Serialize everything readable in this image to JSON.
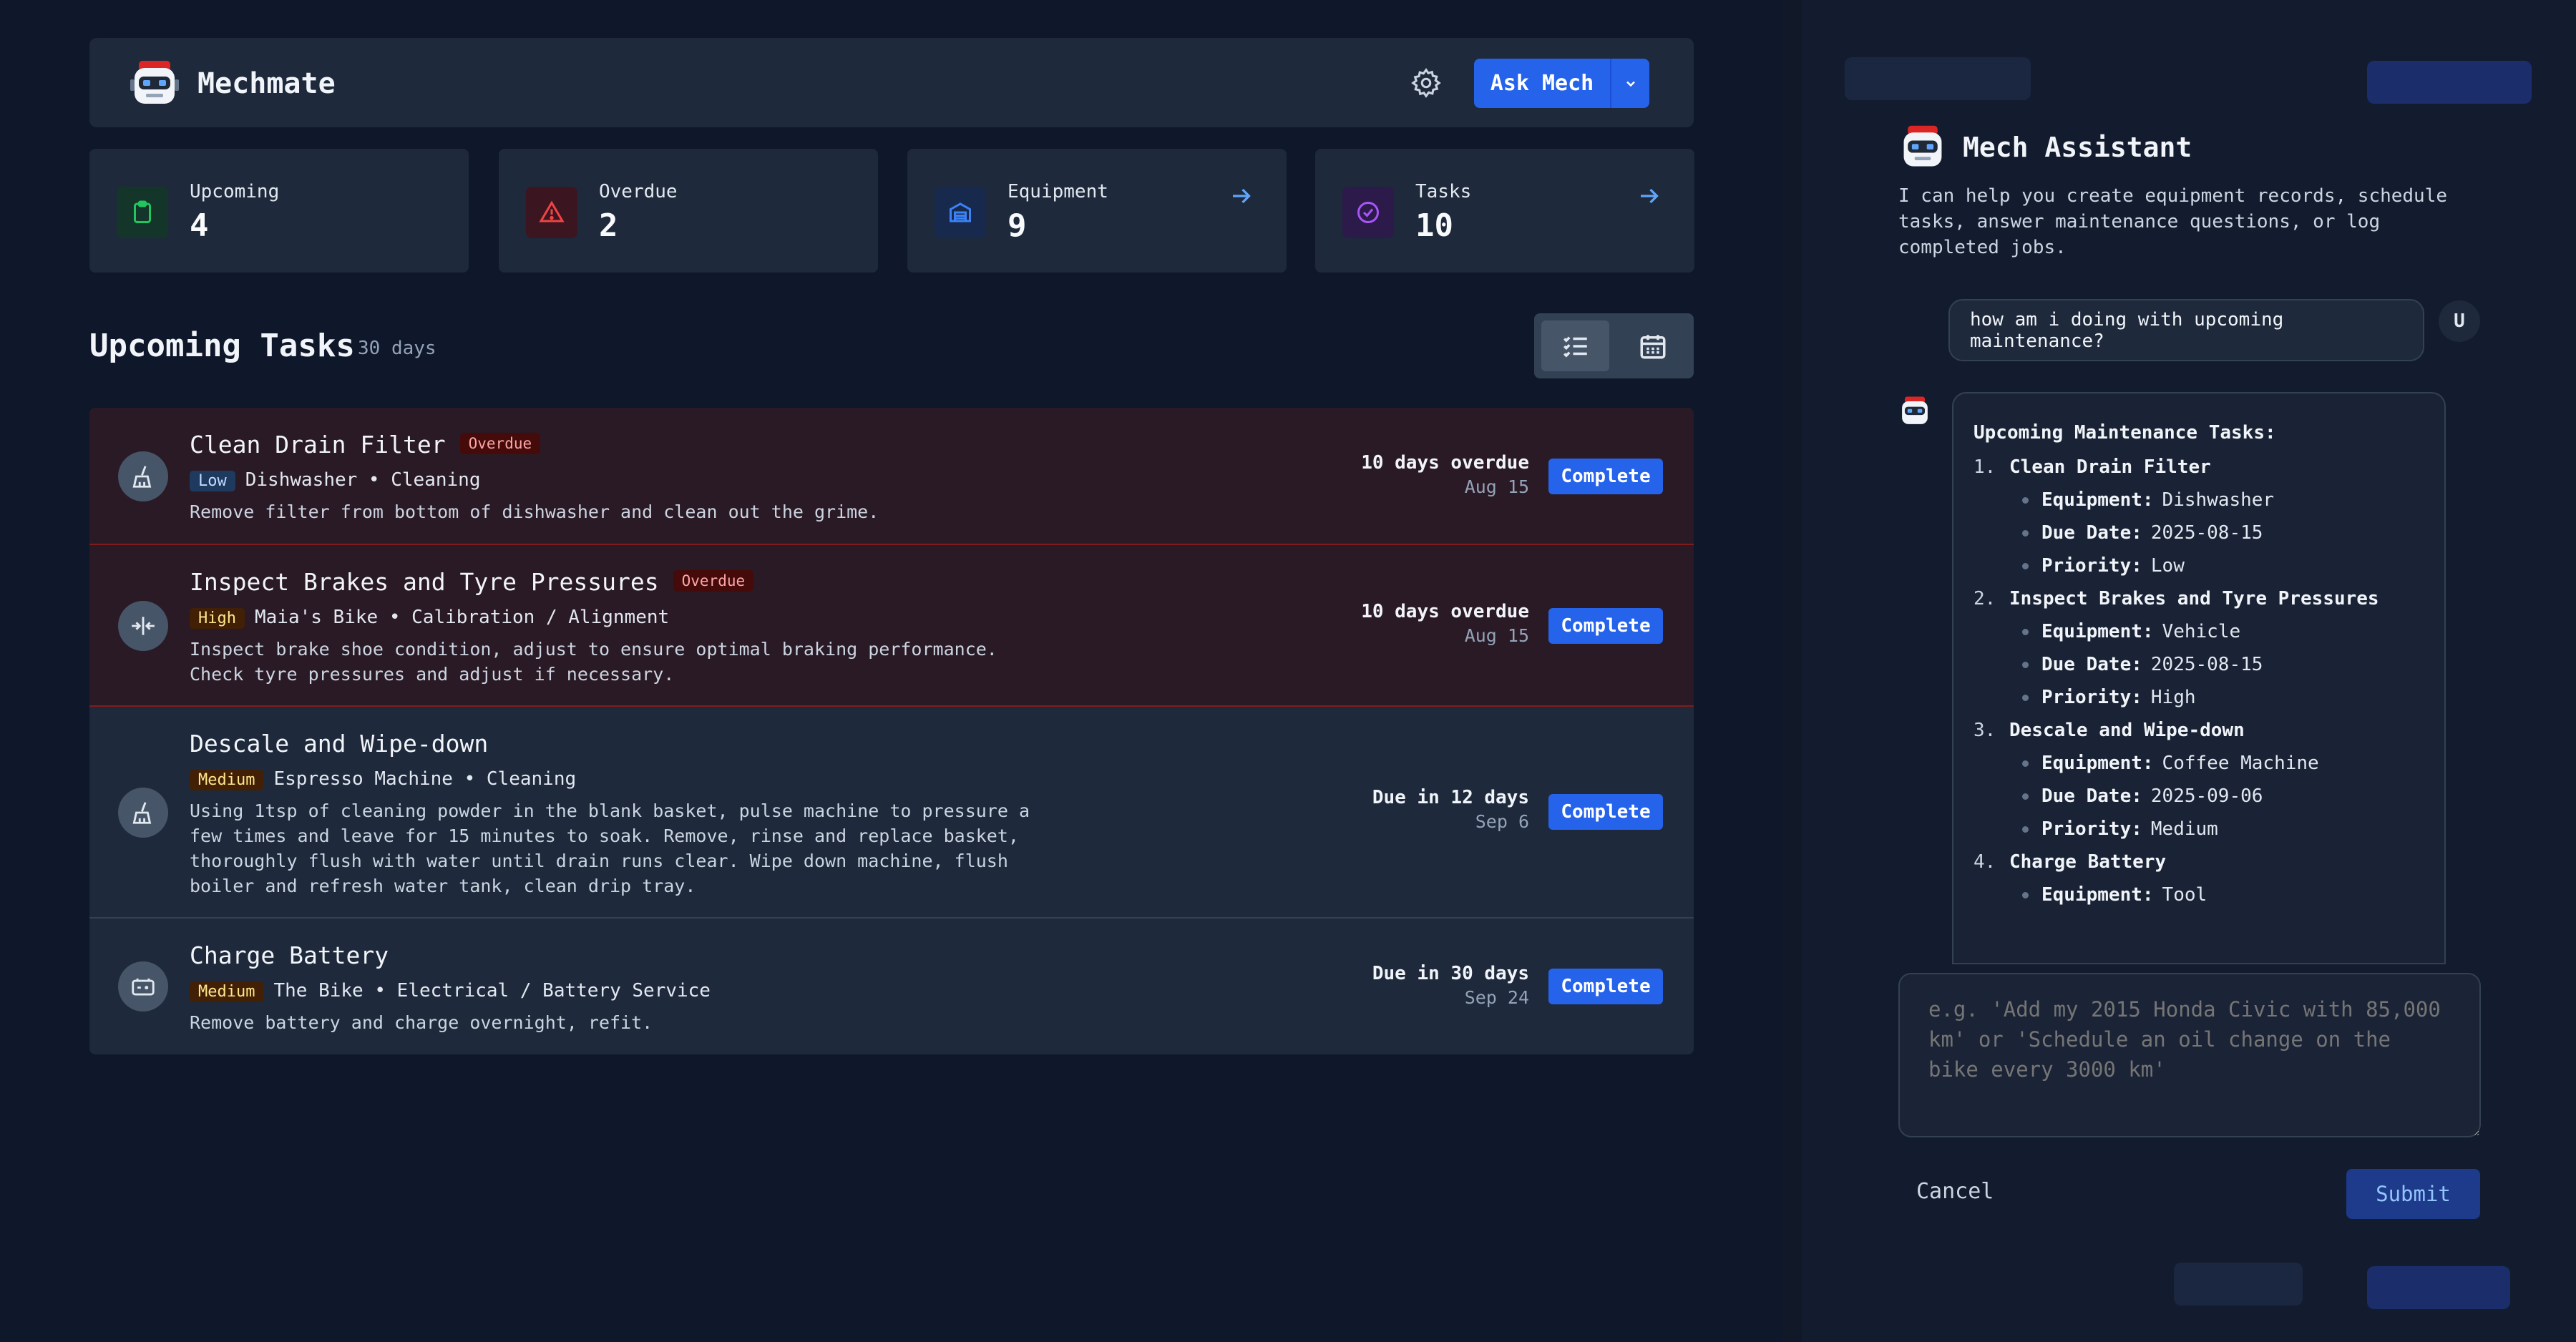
{
  "app": {
    "name": "Mechmate",
    "ask_label": "Ask Mech",
    "stats": [
      {
        "label": "Upcoming",
        "value": "4",
        "icon": "clipboard-icon",
        "color": "#22c55e"
      },
      {
        "label": "Overdue",
        "value": "2",
        "icon": "warning-icon",
        "color": "#ef4444"
      },
      {
        "label": "Equipment",
        "value": "9",
        "icon": "warehouse-icon",
        "color": "#3b82f6"
      },
      {
        "label": "Tasks",
        "value": "10",
        "icon": "check-circle-icon",
        "color": "#a855f7"
      }
    ],
    "section_title": "Upcoming Tasks",
    "section_sub": "30 days",
    "complete_label": "Complete",
    "tasks": [
      {
        "title": "Clean Drain Filter",
        "badge": "Overdue",
        "priority": "Low",
        "meta": "Dishwasher • Cleaning",
        "desc": "Remove filter from bottom of dishwasher and clean out the grime.",
        "due": "10 days overdue",
        "date": "Aug 15",
        "icon": "broom-icon"
      },
      {
        "title": "Inspect Brakes and Tyre Pressures",
        "badge": "Overdue",
        "priority": "High",
        "meta": "Maia's Bike • Calibration / Alignment",
        "desc": "Inspect brake shoe condition, adjust to ensure optimal braking performance. Check tyre pressures and adjust if necessary.",
        "due": "10 days overdue",
        "date": "Aug 15",
        "icon": "align-icon"
      },
      {
        "title": "Descale and Wipe-down",
        "badge": "",
        "priority": "Medium",
        "meta": "Espresso Machine • Cleaning",
        "desc": "Using 1tsp of cleaning powder in the blank basket, pulse machine to pressure a few times and leave for 15 minutes to soak. Remove, rinse and replace basket, thoroughly flush with water until drain runs clear. Wipe down machine, flush boiler and refresh water tank, clean drip tray.",
        "due": "Due in 12 days",
        "date": "Sep 6",
        "icon": "broom-icon"
      },
      {
        "title": "Charge Battery",
        "badge": "",
        "priority": "Medium",
        "meta": "The Bike • Electrical / Battery Service",
        "desc": "Remove battery and charge overnight, refit.",
        "due": "Due in 30 days",
        "date": "Sep 24",
        "icon": "battery-icon"
      }
    ]
  },
  "panel": {
    "title": "Mech Assistant",
    "intro": "I can help you create equipment records, schedule tasks, answer maintenance questions, or log completed jobs.",
    "user_message": "how am i doing with upcoming maintenance?",
    "user_avatar": "U",
    "reply_heading": "Upcoming Maintenance Tasks:",
    "key_equipment": "Equipment:",
    "key_due": "Due Date:",
    "key_priority": "Priority:",
    "reply_items": [
      {
        "num": "1.",
        "title": "Clean Drain Filter",
        "equipment": "Dishwasher",
        "due": "2025-08-15",
        "priority": "Low"
      },
      {
        "num": "2.",
        "title": "Inspect Brakes and Tyre Pressures",
        "equipment": "Vehicle",
        "due": "2025-08-15",
        "priority": "High"
      },
      {
        "num": "3.",
        "title": "Descale and Wipe-down",
        "equipment": "Coffee Machine",
        "due": "2025-09-06",
        "priority": "Medium"
      },
      {
        "num": "4.",
        "title": "Charge Battery",
        "equipment": "Tool",
        "due": "",
        "priority": ""
      }
    ],
    "input_placeholder": "e.g. 'Add my 2015 Honda Civic with 85,000 km' or 'Schedule an oil change on the bike every 3000 km'",
    "cancel_label": "Cancel",
    "submit_label": "Submit"
  }
}
